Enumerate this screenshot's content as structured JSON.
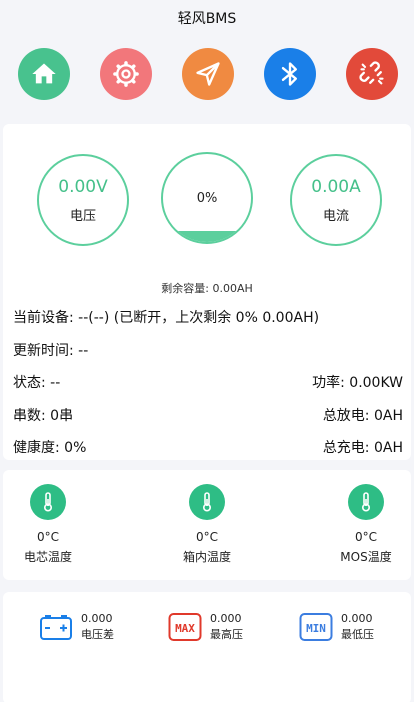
{
  "app": {
    "title": "轻风BMS"
  },
  "nav": [
    {
      "name": "home",
      "color": "#48c28e"
    },
    {
      "name": "settings",
      "color": "#f2777b"
    },
    {
      "name": "send",
      "color": "#f08a41"
    },
    {
      "name": "bluetooth",
      "color": "#1a7fe8"
    },
    {
      "name": "disconnect",
      "color": "#e24a3a"
    }
  ],
  "gauges": {
    "voltage": {
      "value": "0.00V",
      "label": "电压"
    },
    "soc": {
      "value": "0%",
      "fill_fraction": 0.12
    },
    "current": {
      "value": "0.00A",
      "label": "电流"
    }
  },
  "remaining": "剩余容量: 0.00AH",
  "info": {
    "device": "当前设备: --(--) (已断开，上次剩余 0% 0.00AH)",
    "update_time": "更新时间: --",
    "status": "状态: --",
    "power": "功率: 0.00KW",
    "series": "串数: 0串",
    "total_discharge": "总放电: 0AH",
    "health": "健康度: 0%",
    "total_charge": "总充电: 0AH"
  },
  "temps": [
    {
      "value": "0°C",
      "label": "电芯温度"
    },
    {
      "value": "0°C",
      "label": "箱内温度"
    },
    {
      "value": "0°C",
      "label": "MOS温度"
    }
  ],
  "volts": [
    {
      "value": "0.000",
      "label": "电压差",
      "icon": "battery-icon",
      "color": "#1a7fe8"
    },
    {
      "value": "0.000",
      "label": "最高压",
      "icon": "max-icon",
      "color": "#e0392b"
    },
    {
      "value": "0.000",
      "label": "最低压",
      "icon": "min-icon",
      "color": "#3b7de0"
    }
  ]
}
